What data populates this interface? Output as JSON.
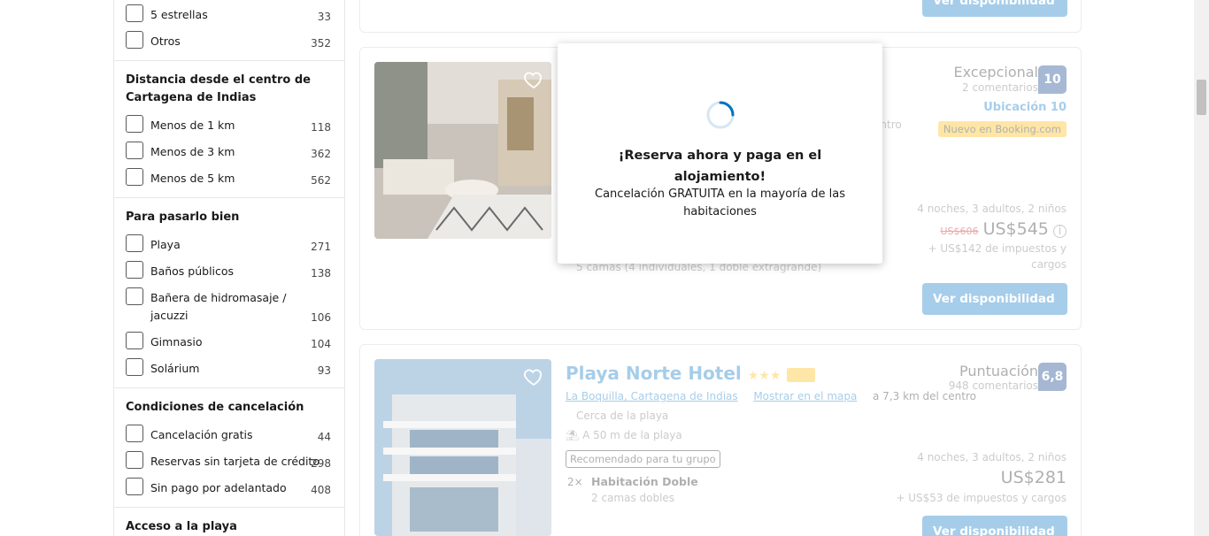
{
  "filters": {
    "stars_group": {
      "options": [
        {
          "label": "5 estrellas",
          "count": "33"
        },
        {
          "label": "Otros",
          "count": "352"
        }
      ]
    },
    "distance_group": {
      "title_line1": "Distancia desde el centro de",
      "title_line2": "Cartagena de Indias",
      "options": [
        {
          "label": "Menos de 1 km",
          "count": "118"
        },
        {
          "label": "Menos de 3 km",
          "count": "362"
        },
        {
          "label": "Menos de 5 km",
          "count": "562"
        }
      ]
    },
    "fun_group": {
      "title": "Para pasarlo bien",
      "options": [
        {
          "label": "Playa",
          "count": "271"
        },
        {
          "label": "Baños públicos",
          "count": "138"
        },
        {
          "label_line1": "Bañera de hidromasaje /",
          "label_line2": "jacuzzi",
          "count": "106"
        },
        {
          "label": "Gimnasio",
          "count": "104"
        },
        {
          "label": "Solárium",
          "count": "93"
        }
      ]
    },
    "cancel_group": {
      "title": "Condiciones de cancelación",
      "options": [
        {
          "label": "Cancelación gratis",
          "count": "44"
        },
        {
          "label": "Reservas sin tarjeta de crédito",
          "count": "298"
        },
        {
          "label": "Sin pago por adelantado",
          "count": "408"
        }
      ]
    },
    "beach_group": {
      "title": "Acceso a la playa"
    }
  },
  "card_top": {
    "availability_label": "Ver disponibilidad"
  },
  "card_1": {
    "score_word": "Excepcional",
    "reviews": "2 comentarios",
    "score": "10",
    "location_score": "Ubicación 10",
    "new_badge": "Nuevo en Booking.com",
    "distance_fragment": "entro",
    "stay_info": "4 noches, 3 adultos, 2 niños",
    "old_price": "US$606",
    "price": "US$545",
    "taxes_line1": "+ US$142 de impuestos y",
    "taxes_line2": "cargos",
    "beds": "5 camas (4 individuales, 1 doble extragrande)",
    "availability_label": "Ver disponibilidad"
  },
  "card_2": {
    "name": "Playa Norte Hotel",
    "location": "La Boquilla, Cartagena de Indias",
    "map_link": "Mostrar en el mapa",
    "distance": "a 7,3 km del centro",
    "near_beach": "Cerca de la playa",
    "beach_distance": "A 50 m de la playa",
    "recommended": "Recomendado para tu grupo",
    "room_qty": "2×",
    "room_type": "Habitación Doble",
    "room_beds": "2 camas dobles",
    "score_word": "Puntuación",
    "reviews": "948 comentarios",
    "score": "6,8",
    "stay_info": "4 noches, 3 adultos, 2 niños",
    "price": "US$281",
    "taxes": "+ US$53 de impuestos y cargos",
    "availability_label": "Ver disponibilidad"
  },
  "modal": {
    "title": "¡Reserva ahora y paga en el alojamiento!",
    "subtitle": "Cancelación GRATUITA en la mayoría de las habitaciones"
  },
  "colors": {
    "primary": "#0071c2",
    "score_badge": "#003580",
    "new_badge_bg": "#ffb700",
    "old_price": "#cc0000"
  }
}
